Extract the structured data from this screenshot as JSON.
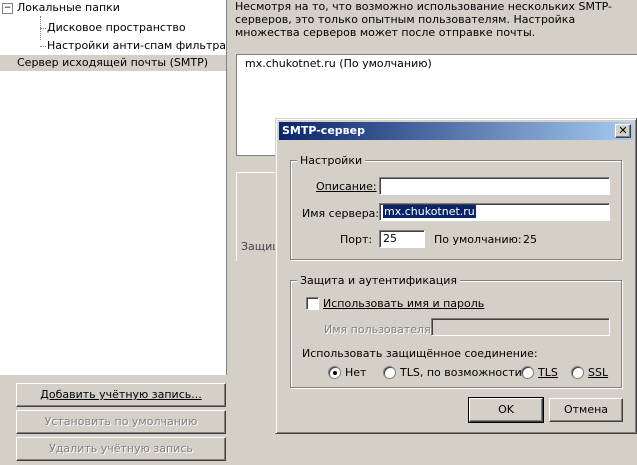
{
  "tree": {
    "local_folders": "Локальные папки",
    "disk_space": "Дисковое пространство",
    "antispam": "Настройки анти-спам фильтра",
    "smtp": "Сервер исходящей почты (SMTP)",
    "expander_symbol": "−"
  },
  "left_buttons": {
    "add_account": "Добавить учётную запись...",
    "set_default": "Установить по умолчанию",
    "delete_account": "Удалить учётную запись"
  },
  "description": "Несмотря на то, что возможно использование нескольких SMTP-серверов, это только опытным пользователям. Настройка множества серверов может после отправке почты.",
  "server_list": [
    "mx.chukotnet.ru (По умолчанию)"
  ],
  "background_panel_text": "Защищ",
  "dialog": {
    "title": "SMTP-сервер",
    "close_symbol": "✕",
    "settings_group": "Настройки",
    "description_label": "Описание:",
    "description_value": "",
    "server_name_label": "Имя сервера:",
    "server_name_value": "mx.chukotnet.ru",
    "port_label": "Порт:",
    "port_value": "25",
    "default_port_label": "По умолчанию:",
    "default_port_value": "25",
    "security_group": "Защита и аутентификация",
    "use_name_password_label": "Использовать имя и пароль",
    "use_name_password_checked": false,
    "username_label": "Имя пользователя:",
    "username_value": "",
    "secure_connection_label": "Использовать защищённое соединение:",
    "connection_options": [
      {
        "label": "Нет",
        "selected": true
      },
      {
        "label": "TLS, по возможности",
        "selected": false
      },
      {
        "label": "TLS",
        "selected": false
      },
      {
        "label": "SSL",
        "selected": false
      }
    ],
    "ok_button": "OK",
    "cancel_button": "Отмена"
  },
  "colors": {
    "titlebar_start": "#0a246a",
    "titlebar_end": "#a6caf0",
    "window_face": "#d4d0c8",
    "selection": "#0a246a"
  }
}
